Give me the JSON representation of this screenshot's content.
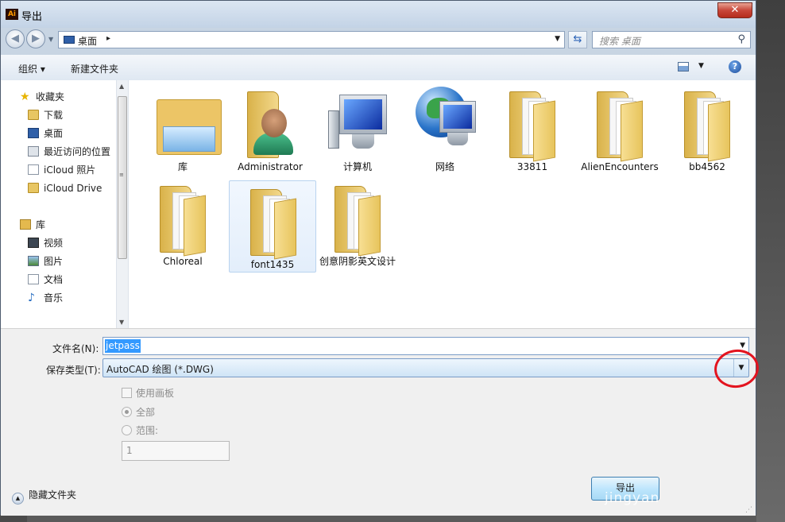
{
  "window": {
    "title": "导出",
    "app_icon": "Ai",
    "close": "✕"
  },
  "address": {
    "location": "桌面",
    "separator": "▸",
    "search_placeholder": "搜索 桌面"
  },
  "toolbar": {
    "organize": "组织 ▾",
    "new_folder": "新建文件夹"
  },
  "nav": {
    "favorites_header": "收藏夹",
    "favorites": [
      "下载",
      "桌面",
      "最近访问的位置",
      "iCloud 照片",
      "iCloud Drive"
    ],
    "library_header": "库",
    "libraries": [
      "视频",
      "图片",
      "文档",
      "音乐"
    ]
  },
  "items": [
    "库",
    "Administrator",
    "计算机",
    "网络",
    "33811",
    "AlienEncounters",
    "bb4562",
    "Chloreal",
    "font1435",
    "创意阴影英文设计"
  ],
  "form": {
    "filename_label": "文件名(N):",
    "filename_value": "jetpass",
    "type_label": "保存类型(T):",
    "type_value": "AutoCAD 绘图 (*.DWG)",
    "use_artboards": "使用画板",
    "all": "全部",
    "range": "范围:",
    "range_value": "1",
    "hide_folders": "隐藏文件夹",
    "export_button": "导出"
  },
  "watermark": "jingyan",
  "colors": {
    "accent": "#3399ff",
    "annotation": "#e3141f"
  }
}
